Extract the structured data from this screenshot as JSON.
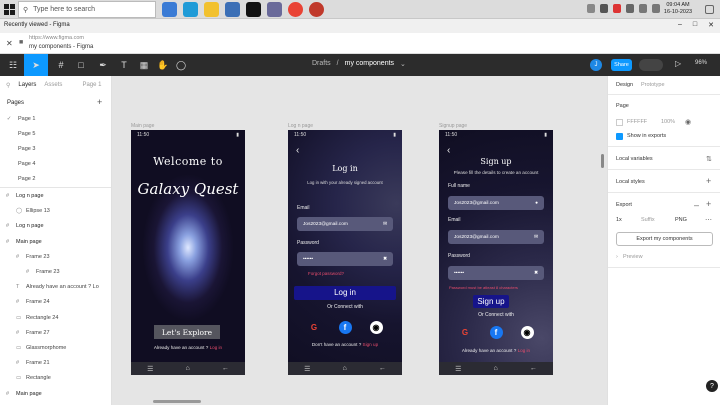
{
  "taskbar": {
    "search_placeholder": "Type here to search",
    "clock_time": "09:04 AM",
    "clock_date": "16-10-2023"
  },
  "browser": {
    "tab_title": "Recently viewed - Figma",
    "url_top": "https://www.figma.com",
    "url_bottom": "my components - Figma"
  },
  "figma": {
    "breadcrumb_root": "Drafts",
    "breadcrumb_sep": "/",
    "breadcrumb_file": "my components",
    "avatar_letter": "J",
    "share_label": "Share",
    "zoom": "96%",
    "accent": "#0d99ff"
  },
  "left_panel": {
    "tab_layers": "Layers",
    "tab_assets": "Assets",
    "page_selector": "Page 1",
    "pages_heading": "Pages",
    "pages": [
      "Page 1",
      "Page 5",
      "Page 3",
      "Page 4",
      "Page 2"
    ],
    "layers": [
      "Log n page",
      "Ellipse 13",
      "Log n page",
      "Main page",
      "Frame 23",
      "Frame 23",
      "Already have an account ? Lo",
      "Frame 24",
      "Rectangle 24",
      "Frame 27",
      "Glassmorphome",
      "Frame 21",
      "Rectangle",
      "Main page"
    ]
  },
  "canvas": {
    "frame_labels": [
      "Main page",
      "Log n page",
      "Signup page"
    ],
    "phone_status_time": "11:50",
    "welcome": {
      "title1": "Welcome to",
      "title2": "Galaxy Quest",
      "button": "Let's Explore",
      "bottom_text": "Already have an account ?",
      "bottom_link": "Log in"
    },
    "login": {
      "title": "Log in",
      "subtitle": "Log in with your already signed account",
      "email_label": "Email",
      "email_value": "Jos2023@gmail.com",
      "password_label": "Password",
      "password_value": "••••••",
      "forgot": "Forgot password?",
      "button": "Log in",
      "connect": "Or Connect with",
      "bottom_text": "Don't have an account ?",
      "bottom_link": "Sign up"
    },
    "signup": {
      "title": "Sign up",
      "subtitle": "Please fill the details to create an account",
      "name_label": "Full name",
      "name_value": "Jos2023@gmail.com",
      "email_label": "Email",
      "email_value": "Jos2023@gmail.com",
      "password_label": "Password",
      "password_value": "••••••",
      "hint": "Password must be atleast 8 characters",
      "button": "Sign up",
      "connect": "Or Connect with",
      "bottom_text": "Already have an account ?",
      "bottom_link": "Log in"
    }
  },
  "right_panel": {
    "tab_design": "Design",
    "tab_prototype": "Prototype",
    "page_heading": "Page",
    "page_color": "FFFFFF",
    "page_opacity": "100%",
    "show_exports": "Show in exports",
    "local_variables": "Local variables",
    "local_styles": "Local styles",
    "export_heading": "Export",
    "export_scale": "1x",
    "export_suffix": "Suffix",
    "export_format": "PNG",
    "export_button": "Export my components",
    "preview": "Preview"
  }
}
